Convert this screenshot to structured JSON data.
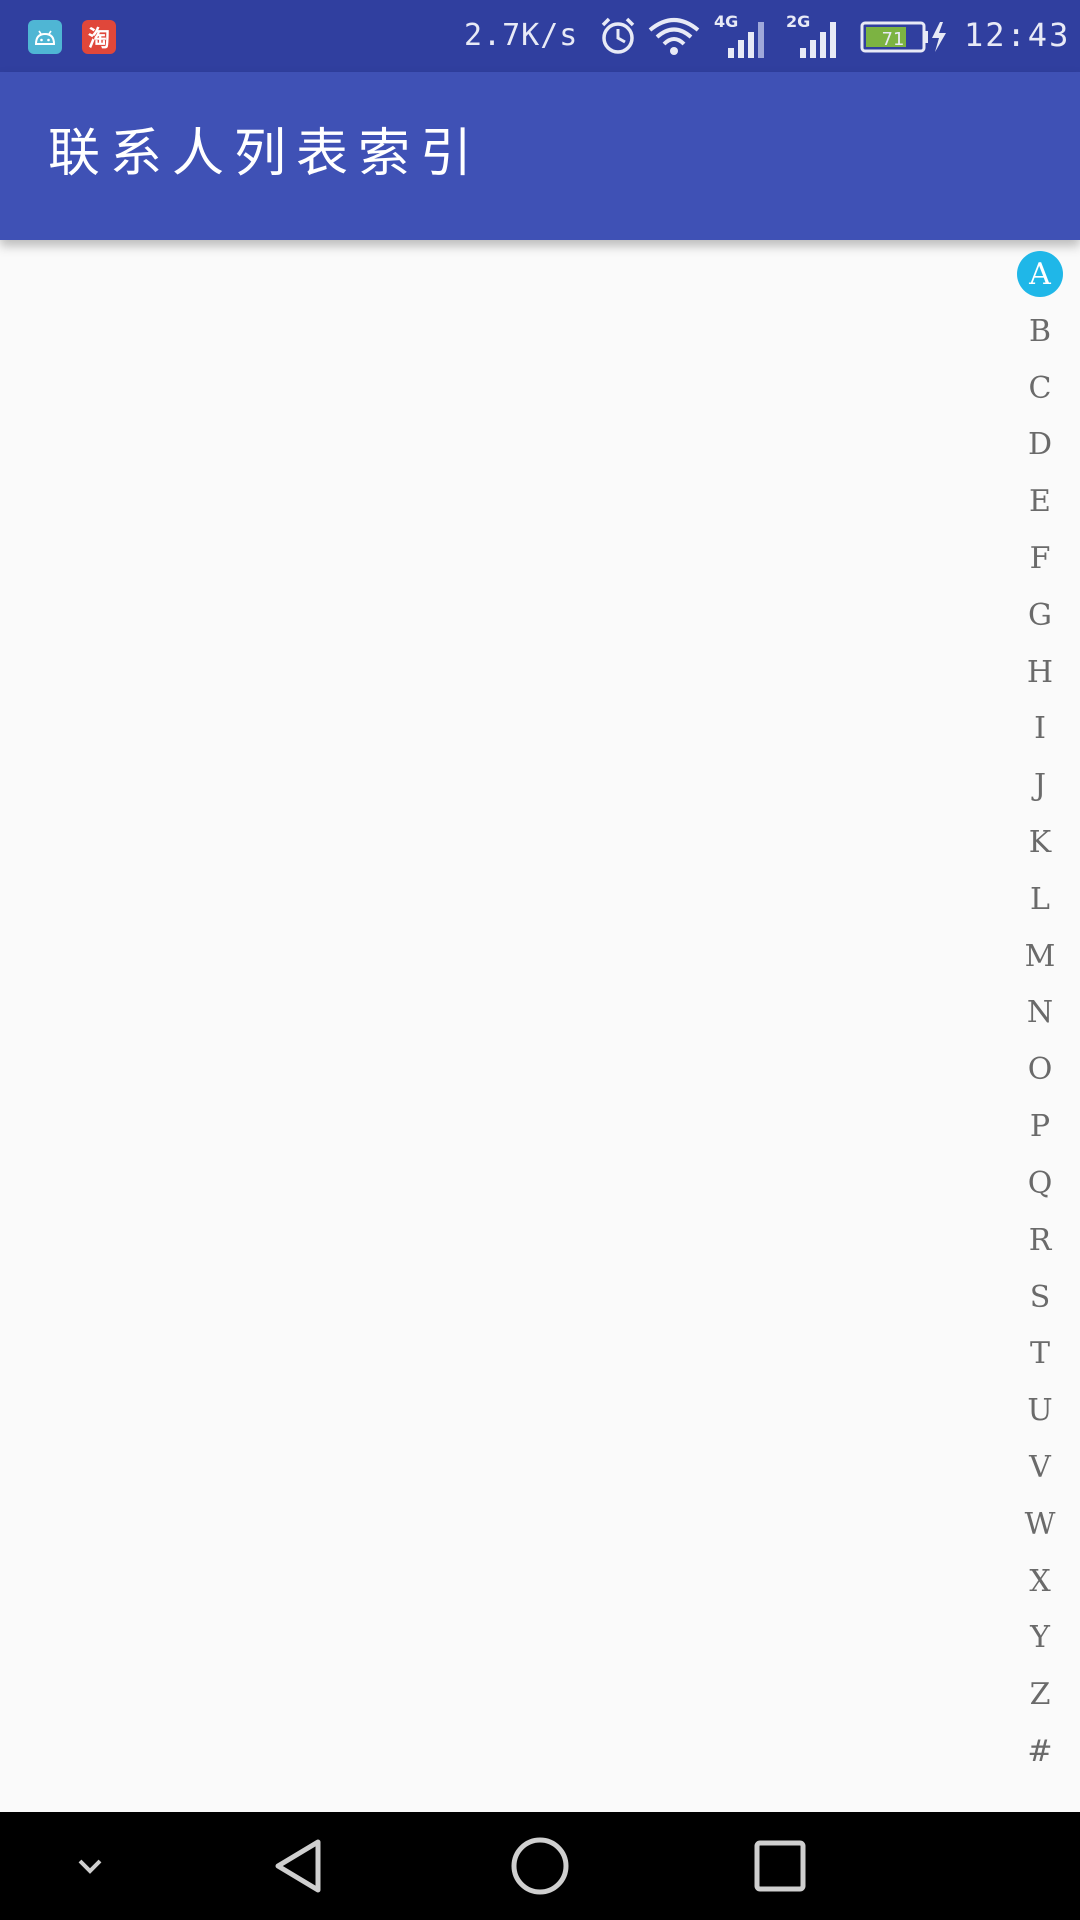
{
  "status_bar": {
    "net_speed": "2.7K/s",
    "time": "12:43",
    "battery_level": "71",
    "signal_4g_label": "4G",
    "signal_2g_label": "2G",
    "notification_icons": [
      "android-debug-icon",
      "taobao-icon"
    ],
    "taobao_glyph": "淘"
  },
  "app_bar": {
    "title": "联系人列表索引",
    "color": "#3f51b5"
  },
  "index": {
    "letters": [
      "A",
      "B",
      "C",
      "D",
      "E",
      "F",
      "G",
      "H",
      "I",
      "J",
      "K",
      "L",
      "M",
      "N",
      "O",
      "P",
      "Q",
      "R",
      "S",
      "T",
      "U",
      "V",
      "W",
      "X",
      "Y",
      "Z",
      "#"
    ],
    "active": "A",
    "active_color": "#1fb7e8"
  },
  "colors": {
    "status_bar": "#303f9f",
    "background": "#fafafa",
    "index_text": "#6a6a6a"
  }
}
